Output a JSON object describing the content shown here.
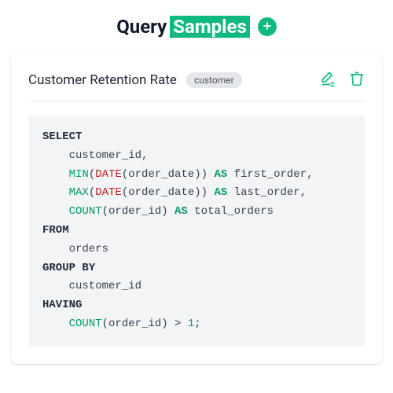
{
  "header": {
    "title_plain": "Query",
    "title_highlight": "Samples"
  },
  "card": {
    "title": "Customer Retention Rate",
    "tag": "customer",
    "sql": {
      "tokens": [
        {
          "t": "SELECT",
          "c": "kw"
        },
        {
          "t": "\n    customer_id,\n    ",
          "c": ""
        },
        {
          "t": "MIN",
          "c": "fn"
        },
        {
          "t": "(",
          "c": ""
        },
        {
          "t": "DATE",
          "c": "fn2"
        },
        {
          "t": "(order_date)) ",
          "c": ""
        },
        {
          "t": "AS",
          "c": "as"
        },
        {
          "t": " first_order,\n    ",
          "c": ""
        },
        {
          "t": "MAX",
          "c": "fn"
        },
        {
          "t": "(",
          "c": ""
        },
        {
          "t": "DATE",
          "c": "fn2"
        },
        {
          "t": "(order_date)) ",
          "c": ""
        },
        {
          "t": "AS",
          "c": "as"
        },
        {
          "t": " last_order,\n    ",
          "c": ""
        },
        {
          "t": "COUNT",
          "c": "fn"
        },
        {
          "t": "(order_id) ",
          "c": ""
        },
        {
          "t": "AS",
          "c": "as"
        },
        {
          "t": " total_orders\n",
          "c": ""
        },
        {
          "t": "FROM",
          "c": "kw"
        },
        {
          "t": "\n    orders\n",
          "c": ""
        },
        {
          "t": "GROUP BY",
          "c": "kw"
        },
        {
          "t": "\n    customer_id\n",
          "c": ""
        },
        {
          "t": "HAVING",
          "c": "kw"
        },
        {
          "t": "\n    ",
          "c": ""
        },
        {
          "t": "COUNT",
          "c": "fn"
        },
        {
          "t": "(order_id) > ",
          "c": ""
        },
        {
          "t": "1",
          "c": "num"
        },
        {
          "t": ";",
          "c": ""
        }
      ]
    }
  },
  "colors": {
    "accent": "#10b981",
    "danger": "#b91c1c"
  }
}
